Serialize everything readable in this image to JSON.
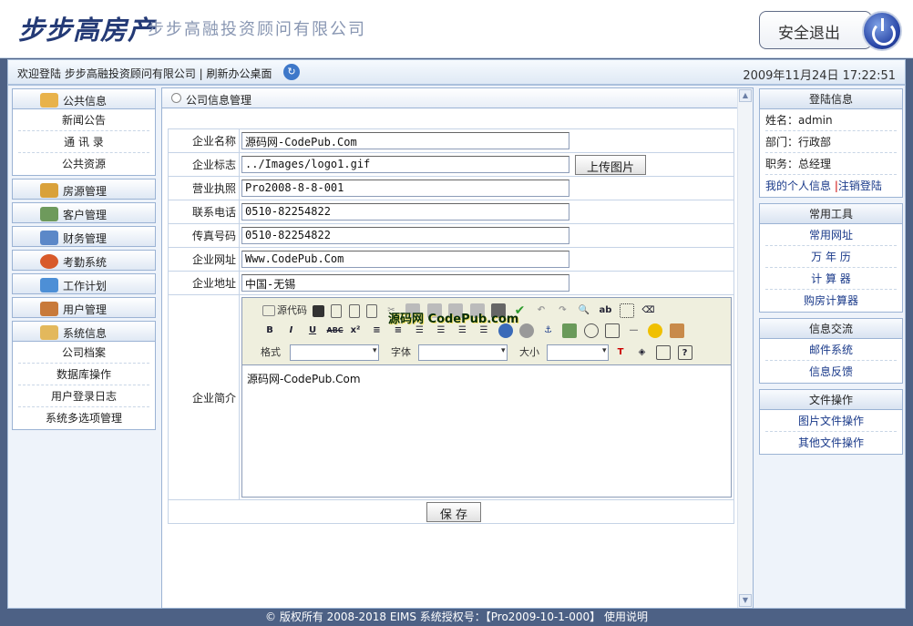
{
  "header": {
    "logo": "步步高房产",
    "company": "步步高融投资顾问有限公司",
    "logout_label": "安全退出"
  },
  "welcome": {
    "text": "欢迎登陆 步步高融投资顾问有限公司 | 刷新办公桌面",
    "datetime": "2009年11月24日  17:22:51"
  },
  "left_menu": {
    "public": "公共信息",
    "public_items": [
      "新闻公告",
      "通 讯 录",
      "公共资源"
    ],
    "items": [
      "房源管理",
      "客户管理",
      "财务管理",
      "考勤系统",
      "工作计划",
      "用户管理"
    ],
    "system": "系统信息",
    "system_items": [
      "公司档案",
      "数据库操作",
      "用户登录日志",
      "系统多选项管理"
    ]
  },
  "center": {
    "title": "公司信息管理",
    "fields": [
      {
        "label": "企业名称",
        "value": "源码网-CodePub.Com"
      },
      {
        "label": "企业标志",
        "value": "../Images/logo1.gif"
      },
      {
        "label": "营业执照",
        "value": "Pro2008-8-8-001"
      },
      {
        "label": "联系电话",
        "value": "0510-82254822"
      },
      {
        "label": "传真号码",
        "value": "0510-82254822"
      },
      {
        "label": "企业网址",
        "value": "Www.CodePub.Com"
      },
      {
        "label": "企业地址",
        "value": "中国-无锡"
      }
    ],
    "upload_label": "上传图片",
    "intro_label": "企业简介",
    "editor": {
      "source": "源代码",
      "format": "格式",
      "font": "字体",
      "size": "大小",
      "content": "源码网-CodePub.Com",
      "watermark": "源码网 CodePub.com"
    },
    "save_label": "保 存"
  },
  "right": {
    "login_title": "登陆信息",
    "name": "姓名：admin",
    "dept": "部门：行政部",
    "post": "职务：总经理",
    "my_info": "我的个人信息",
    "logout": "注销登陆",
    "tools_title": "常用工具",
    "tools": [
      "常用网址",
      "万 年 历",
      "计 算 器",
      "购房计算器"
    ],
    "exchange_title": "信息交流",
    "exchange": [
      "邮件系统",
      "信息反馈"
    ],
    "file_title": "文件操作",
    "files": [
      "图片文件操作",
      "其他文件操作"
    ]
  },
  "footer": "© 版权所有  2008-2018 EIMS 系统授权号：【Pro2009-10-1-000】 使用说明"
}
